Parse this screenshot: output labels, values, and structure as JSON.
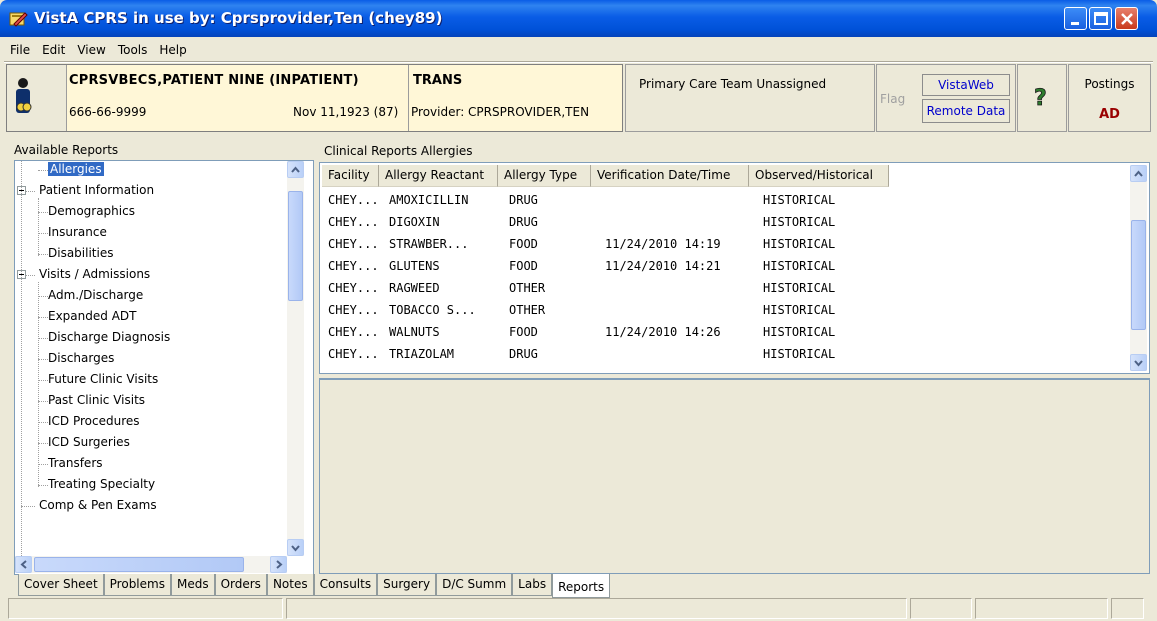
{
  "window": {
    "title": "VistA CPRS in use by: Cprsprovider,Ten  (chey89)"
  },
  "menu": [
    "File",
    "Edit",
    "View",
    "Tools",
    "Help"
  ],
  "patient": {
    "name": "CPRSVBECS,PATIENT NINE (INPATIENT)",
    "ssn": "666-66-9999",
    "dob": "Nov 11,1923 (87)",
    "location": "TRANS",
    "provider": "Provider:  CPRSPROVIDER,TEN"
  },
  "care_team": "Primary Care Team Unassigned",
  "flag_label": "Flag",
  "vistaweb_label": "VistaWeb",
  "remote_data_label": "Remote Data",
  "help_icon": "question-mark-icon",
  "postings": {
    "label": "Postings",
    "value": "AD"
  },
  "left_panel": {
    "title": "Available Reports",
    "tree": [
      {
        "label": "Allergies",
        "level": 1,
        "selected": true
      },
      {
        "label": "Patient Information",
        "level": 0,
        "expanded": true
      },
      {
        "label": "Demographics",
        "level": 1
      },
      {
        "label": "Insurance",
        "level": 1
      },
      {
        "label": "Disabilities",
        "level": 1
      },
      {
        "label": "Visits / Admissions",
        "level": 0,
        "expanded": true
      },
      {
        "label": "Adm./Discharge",
        "level": 1
      },
      {
        "label": "Expanded ADT",
        "level": 1
      },
      {
        "label": "Discharge Diagnosis",
        "level": 1
      },
      {
        "label": "Discharges",
        "level": 1
      },
      {
        "label": "Future Clinic Visits",
        "level": 1
      },
      {
        "label": "Past Clinic Visits",
        "level": 1
      },
      {
        "label": "ICD Procedures",
        "level": 1
      },
      {
        "label": "ICD Surgeries",
        "level": 1
      },
      {
        "label": "Transfers",
        "level": 1
      },
      {
        "label": "Treating Specialty",
        "level": 1
      },
      {
        "label": "Comp & Pen Exams",
        "level": 0
      }
    ]
  },
  "right_panel": {
    "title": "Clinical Reports Allergies",
    "columns": [
      "Facility",
      "Allergy Reactant",
      "Allergy Type",
      "Verification Date/Time",
      "Observed/Historical"
    ],
    "rows": [
      [
        "CHEY...",
        "AMOXICILLIN",
        "DRUG",
        "",
        "HISTORICAL"
      ],
      [
        "CHEY...",
        "DIGOXIN",
        "DRUG",
        "",
        "HISTORICAL"
      ],
      [
        "CHEY...",
        "STRAWBER...",
        "FOOD",
        "11/24/2010 14:19",
        "HISTORICAL"
      ],
      [
        "CHEY...",
        "GLUTENS",
        "FOOD",
        "11/24/2010 14:21",
        "HISTORICAL"
      ],
      [
        "CHEY...",
        "RAGWEED",
        "OTHER",
        "",
        "HISTORICAL"
      ],
      [
        "CHEY...",
        "TOBACCO S...",
        "OTHER",
        "",
        "HISTORICAL"
      ],
      [
        "CHEY...",
        "WALNUTS",
        "FOOD",
        "11/24/2010 14:26",
        "HISTORICAL"
      ],
      [
        "CHEY...",
        "TRIAZOLAM",
        "DRUG",
        "",
        "HISTORICAL"
      ]
    ]
  },
  "tabs": [
    "Cover Sheet",
    "Problems",
    "Meds",
    "Orders",
    "Notes",
    "Consults",
    "Surgery",
    "D/C Summ",
    "Labs",
    "Reports"
  ],
  "active_tab": "Reports",
  "colors": {
    "title_bar": "#0a5de6",
    "selection": "#316ac5",
    "patient_box": "#fff7d7",
    "postings_value": "#990000",
    "link_blue": "#0000cc"
  }
}
